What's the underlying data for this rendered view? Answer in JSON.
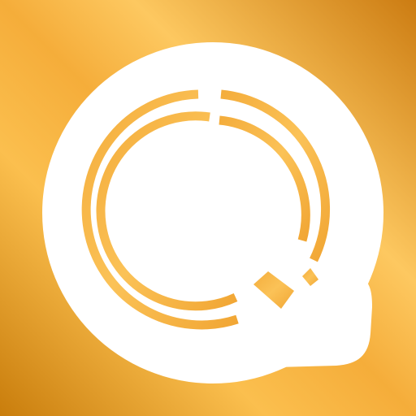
{
  "icon": {
    "name": "ring-q-logo-icon",
    "colors": {
      "background_dark": "#c97d0c",
      "background_light": "#fbbf4e",
      "mark": "#ffffff",
      "ring": "#f7b544"
    }
  }
}
